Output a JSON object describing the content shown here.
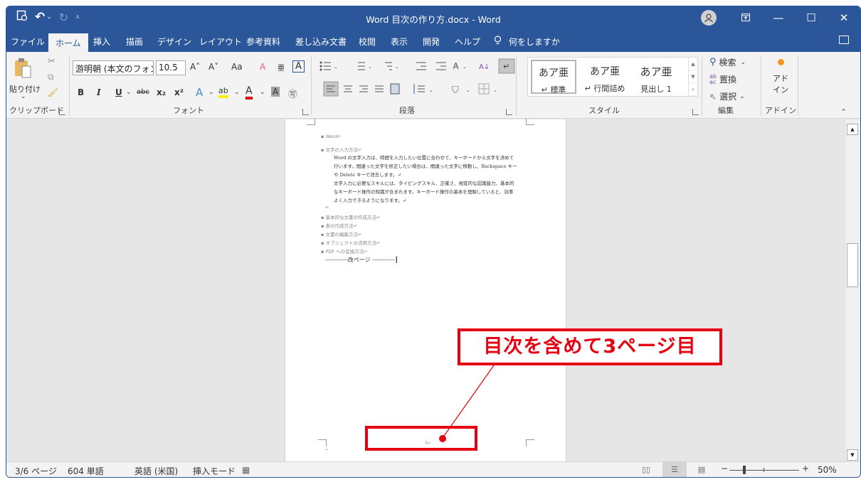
{
  "titlebar": {
    "title": "Word  目次の作り方.docx  -  Word",
    "qat": {
      "save_icon": "⟲",
      "undo_icon": "↶",
      "undo_dropdown": "⌄",
      "redo_icon": "↻",
      "customize": "⩡"
    },
    "window_controls": {
      "ribbon_display": "⬆",
      "minimize": "—",
      "maximize": "☐",
      "close": "✕"
    }
  },
  "tabs": [
    {
      "label": "ファイル"
    },
    {
      "label": "ホーム",
      "active": true
    },
    {
      "label": "挿入"
    },
    {
      "label": "描画"
    },
    {
      "label": "デザイン"
    },
    {
      "label": "レイアウト"
    },
    {
      "label": "参考資料"
    },
    {
      "label": "差し込み文書"
    },
    {
      "label": "校閲"
    },
    {
      "label": "表示"
    },
    {
      "label": "開発"
    },
    {
      "label": "ヘルプ"
    }
  ],
  "tell_me": {
    "icon": "💡",
    "label": "何をしますか"
  },
  "ribbon": {
    "clipboard": {
      "paste_label": "貼り付け",
      "paste_dropdown": "⌄",
      "group_label": "クリップボード"
    },
    "font": {
      "font_name": "游明朝 (本文のフォン",
      "font_size": "10.5",
      "grow": "A˄",
      "shrink": "A˅",
      "change_case": "Aa",
      "bold": "B",
      "italic": "I",
      "underline": "U",
      "strikethrough": "abc",
      "subscript": "x₂",
      "superscript": "x²",
      "text_effects": "A",
      "highlight": "ab",
      "font_color": "A",
      "char_shading": "A",
      "enclose": "㊢",
      "clear_format": "A",
      "phonetic": "亜",
      "char_border": "A",
      "group_label": "フォント"
    },
    "paragraph": {
      "group_label": "段落"
    },
    "styles": {
      "items": [
        {
          "sample": "あア亜",
          "name": "↵ 標準",
          "selected": true
        },
        {
          "sample": "あア亜",
          "name": "↵ 行間詰め"
        },
        {
          "sample": "あア亜",
          "name": "見出し 1"
        }
      ],
      "group_label": "スタイル"
    },
    "editing": {
      "find": "検索",
      "replace": "置換",
      "select": "選択",
      "group_label": "編集"
    },
    "addins": {
      "button_label_1": "アド",
      "button_label_2": "イン",
      "group_label": "アドイン"
    }
  },
  "document": {
    "lines": [
      {
        "text": "▪ Word↵",
        "style": "gray"
      },
      {
        "text": "▪ 文字の入力方法↵",
        "style": "gray"
      },
      {
        "text": "Word の文字入力は、時間を入力したい位置に合わせて、キーボードから文字を決めて",
        "style": "body"
      },
      {
        "text": "行います。間違った文字を修正したい場合は、間違った文字に移動し、Backspace キー",
        "style": "body"
      },
      {
        "text": "や Delete キーで消去します。↵",
        "style": "body"
      },
      {
        "text": "文字入力に必要なスキルには、タイピングスキル、正確さ、視覚的な認識能力、基本的",
        "style": "body"
      },
      {
        "text": "なキーボード操作の知識が含まれます。キーボード操作の基本を理解していると、効率",
        "style": "body"
      },
      {
        "text": "よく入力できるようになります。↵",
        "style": "body"
      },
      {
        "text": "↵",
        "style": "gray"
      },
      {
        "text": "▪ 基本的な文書の作成方法↵",
        "style": "gray"
      },
      {
        "text": "▪ 表の作成方法↵",
        "style": "gray"
      },
      {
        "text": "▪ 文書の編集方法↵",
        "style": "gray"
      },
      {
        "text": "▪ オブジェクトの活用方法↵",
        "style": "gray"
      },
      {
        "text": "▪ PDF への変換方法↵",
        "style": "gray"
      }
    ],
    "page_break": "-----------改ページ -----------┃",
    "footer_page_number": "3↵",
    "footer_mark": "↵"
  },
  "annotation": {
    "callout_text": "目次を含めて3ページ目",
    "color": "#e60012"
  },
  "statusbar": {
    "page": "3/6 ページ",
    "words": "604 単語",
    "language": "英語 (米国)",
    "mode": "挿入モード",
    "zoom_minus": "−",
    "zoom_plus": "+",
    "zoom_level": "50%",
    "zoom_percent": 50
  },
  "colors": {
    "brand": "#2b579a",
    "annotation": "#e60012"
  }
}
